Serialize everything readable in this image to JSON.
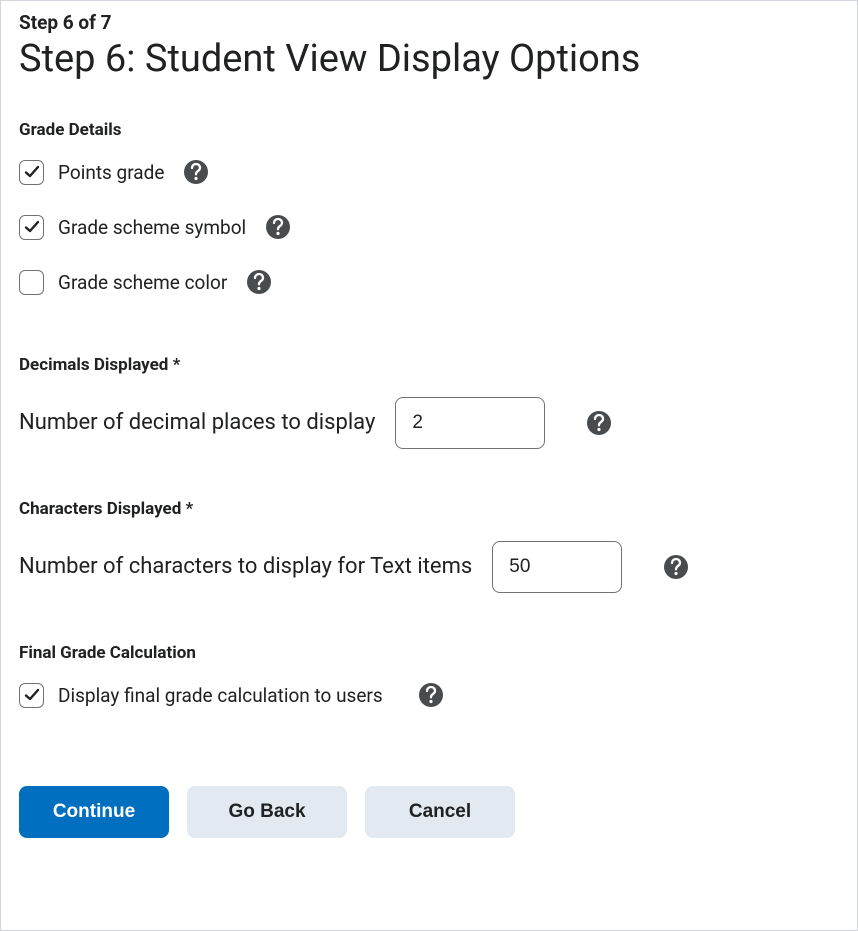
{
  "header": {
    "step_of": "Step 6 of 7",
    "title": "Step 6: Student View Display Options"
  },
  "grade_details": {
    "heading": "Grade Details",
    "items": [
      {
        "label": "Points grade",
        "checked": true
      },
      {
        "label": "Grade scheme symbol",
        "checked": true
      },
      {
        "label": "Grade scheme color",
        "checked": false
      }
    ]
  },
  "decimals": {
    "heading": "Decimals Displayed *",
    "label": "Number of decimal places to display",
    "value": "2"
  },
  "characters": {
    "heading": "Characters Displayed *",
    "label": "Number of characters to display for Text items",
    "value": "50"
  },
  "final_grade": {
    "heading": "Final Grade Calculation",
    "label": "Display final grade calculation to users",
    "checked": true
  },
  "buttons": {
    "continue": "Continue",
    "go_back": "Go Back",
    "cancel": "Cancel"
  }
}
